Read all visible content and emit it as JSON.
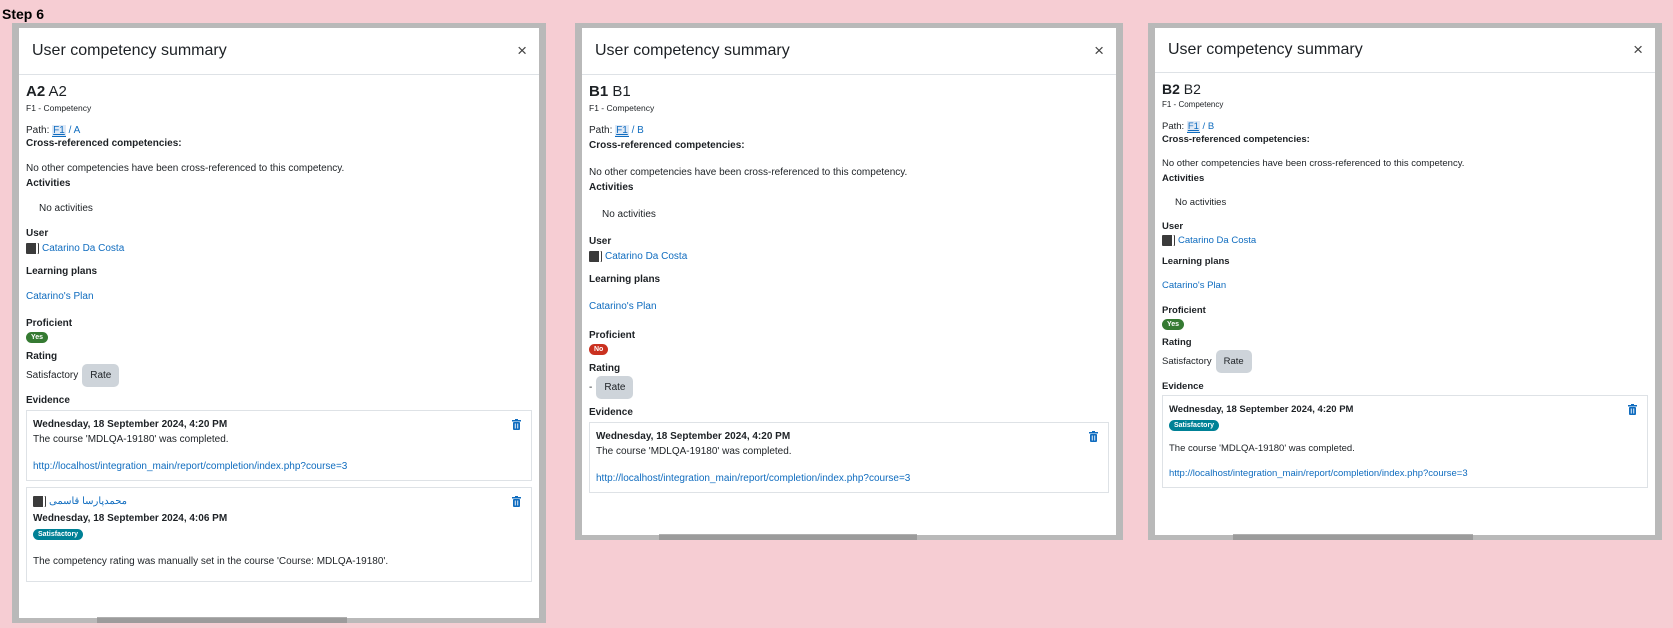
{
  "step_label": "Step 6",
  "dialogs": [
    {
      "title": "User competency summary",
      "close_label": "×",
      "competency_id": "A2",
      "competency_name": "A2",
      "framework": "F1 - Competency",
      "path_label": "Path:",
      "path_root": "F1",
      "path_sep": " / ",
      "path_child": "A",
      "crossref_title": "Cross-referenced competencies:",
      "crossref_text": "No other competencies have been cross-referenced to this competency.",
      "activities_title": "Activities",
      "activities_text": "No activities",
      "user_title": "User",
      "user_name": "Catarino Da Costa",
      "plans_title": "Learning plans",
      "plan_name": "Catarino's Plan",
      "proficient_title": "Proficient",
      "proficient_value": "Yes",
      "rating_title": "Rating",
      "rating_value": "Satisfactory",
      "rate_button": "Rate",
      "evidence_title": "Evidence",
      "evidence": [
        {
          "date": "Wednesday, 18 September 2024, 4:20 PM",
          "desc": "The course 'MDLQA-19180' was completed.",
          "url": "http://localhost/integration_main/report/completion/index.php?course=3"
        },
        {
          "user": "محمدپارسا قاسمی",
          "date": "Wednesday, 18 September 2024, 4:06 PM",
          "badge": "Satisfactory",
          "desc": "The competency rating was manually set in the course 'Course: MDLQA-19180'."
        }
      ]
    },
    {
      "title": "User competency summary",
      "close_label": "×",
      "competency_id": "B1",
      "competency_name": "B1",
      "framework": "F1 - Competency",
      "path_label": "Path:",
      "path_root": "F1",
      "path_sep": " / ",
      "path_child": "B",
      "crossref_title": "Cross-referenced competencies:",
      "crossref_text": "No other competencies have been cross-referenced to this competency.",
      "activities_title": "Activities",
      "activities_text": "No activities",
      "user_title": "User",
      "user_name": "Catarino Da Costa",
      "plans_title": "Learning plans",
      "plan_name": "Catarino's Plan",
      "proficient_title": "Proficient",
      "proficient_value": "No",
      "rating_title": "Rating",
      "rating_value": "-",
      "rate_button": "Rate",
      "evidence_title": "Evidence",
      "evidence": [
        {
          "date": "Wednesday, 18 September 2024, 4:20 PM",
          "desc": "The course 'MDLQA-19180' was completed.",
          "url": "http://localhost/integration_main/report/completion/index.php?course=3"
        }
      ]
    },
    {
      "title": "User competency summary",
      "close_label": "×",
      "competency_id": "B2",
      "competency_name": "B2",
      "framework": "F1 - Competency",
      "path_label": "Path:",
      "path_root": "F1",
      "path_sep": " / ",
      "path_child": "B",
      "crossref_title": "Cross-referenced competencies:",
      "crossref_text": "No other competencies have been cross-referenced to this competency.",
      "activities_title": "Activities",
      "activities_text": "No activities",
      "user_title": "User",
      "user_name": "Catarino Da Costa",
      "plans_title": "Learning plans",
      "plan_name": "Catarino's Plan",
      "proficient_title": "Proficient",
      "proficient_value": "Yes",
      "rating_title": "Rating",
      "rating_value": "Satisfactory",
      "rate_button": "Rate",
      "evidence_title": "Evidence",
      "evidence": [
        {
          "date": "Wednesday, 18 September 2024, 4:20 PM",
          "badge": "Satisfactory",
          "desc": "The course 'MDLQA-19180' was completed.",
          "url": "http://localhost/integration_main/report/completion/index.php?course=3"
        }
      ]
    }
  ],
  "colors": {
    "page_background": "#f6cdd3",
    "link": "#0f6cbf",
    "badge_yes": "#357a32",
    "badge_no": "#ca3120",
    "badge_satisfactory": "#008196"
  }
}
